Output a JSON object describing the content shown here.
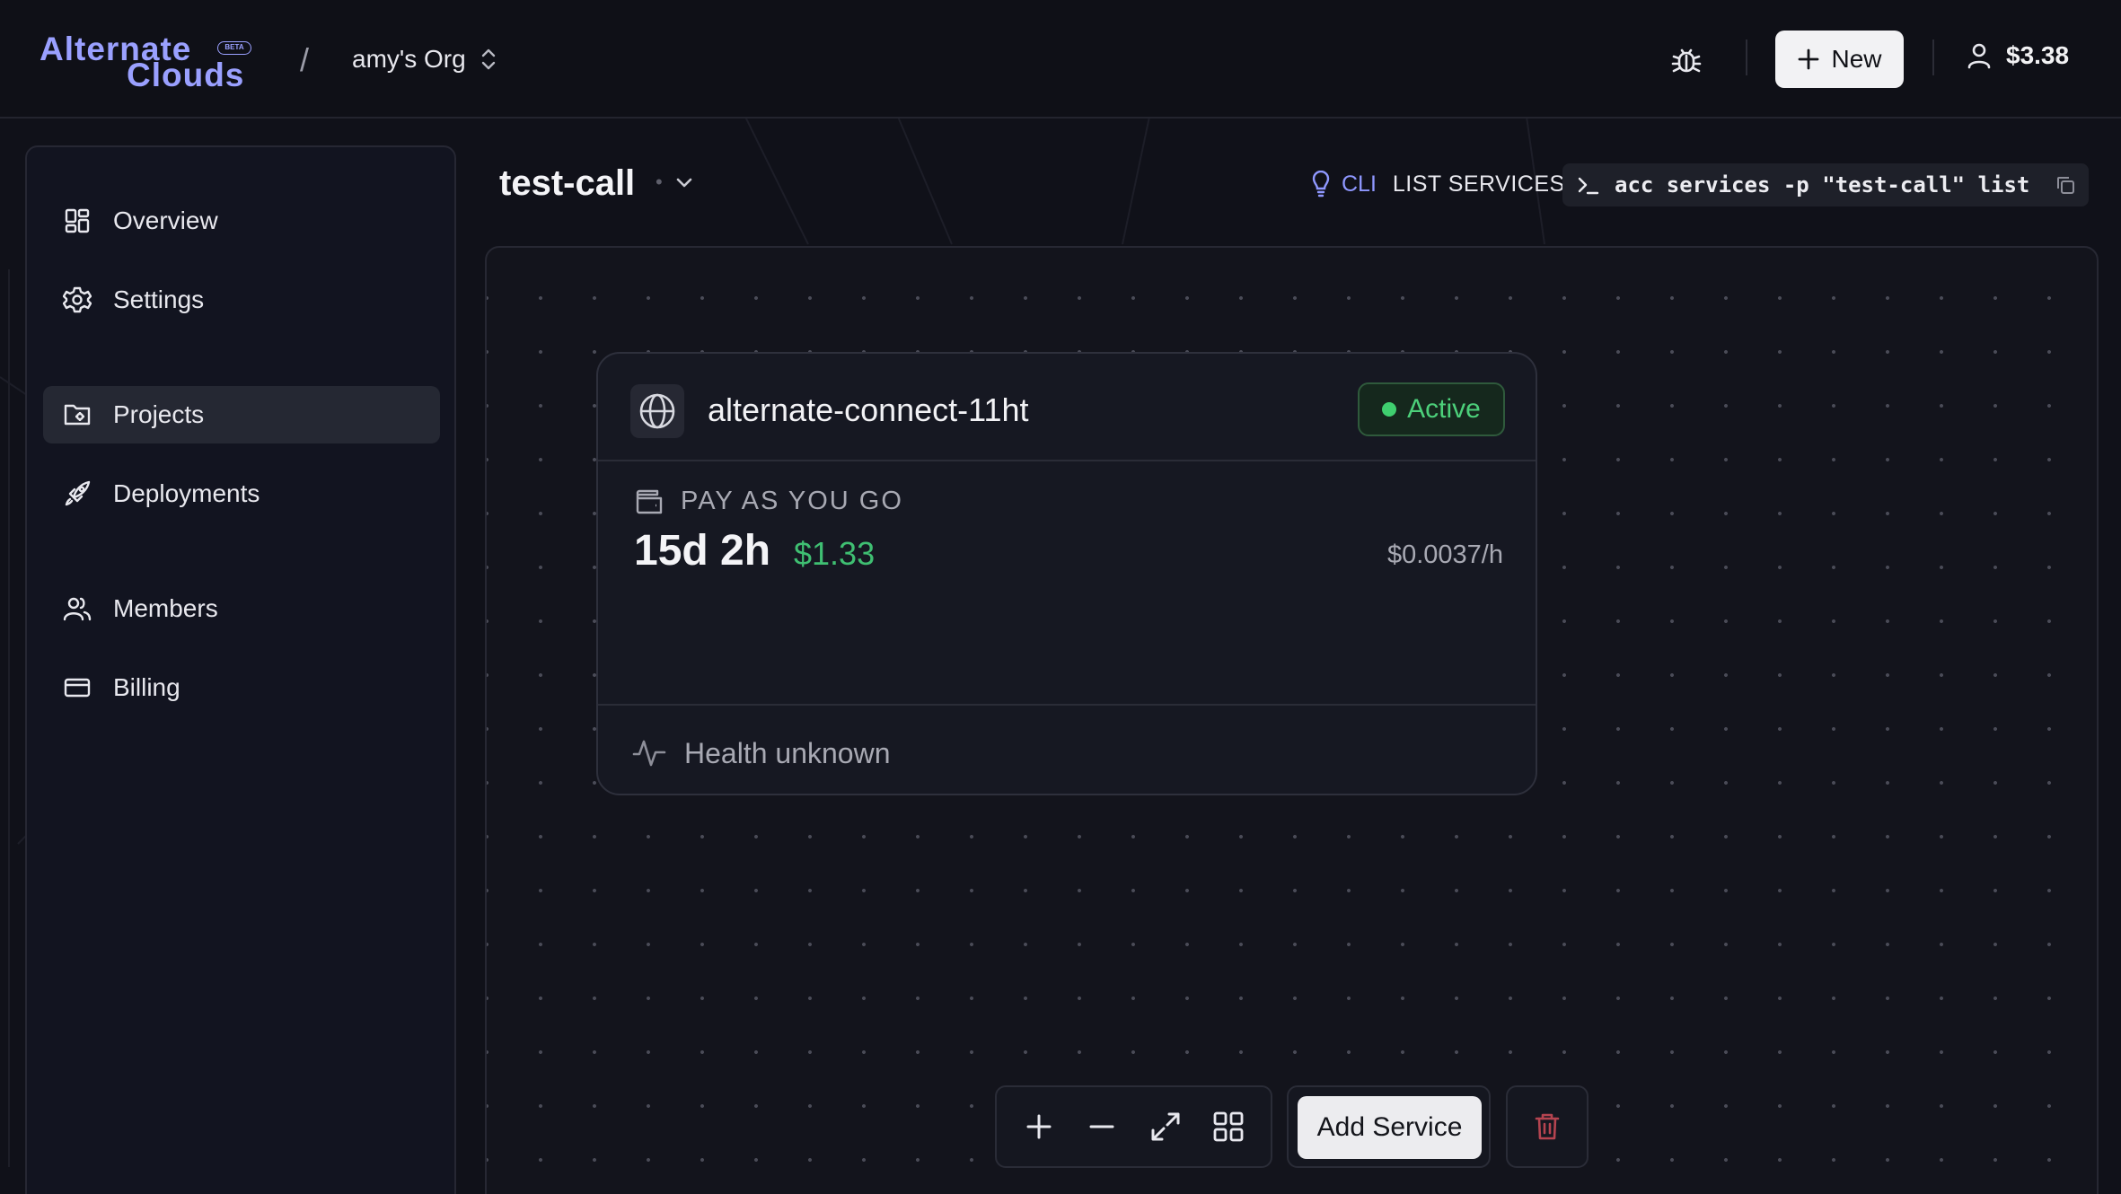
{
  "brand": {
    "line1": "Alternate",
    "line2": "Clouds",
    "badge": "BETA",
    "color": "#9aa0ff"
  },
  "breadcrumb": {
    "separator": "/",
    "org": "amy's Org"
  },
  "header": {
    "new_label": "New",
    "balance": "$3.38"
  },
  "sidebar": {
    "items": [
      {
        "label": "Overview",
        "icon": "grid-icon"
      },
      {
        "label": "Settings",
        "icon": "gear-icon"
      },
      {
        "label": "Projects",
        "icon": "folder-icon",
        "active": true
      },
      {
        "label": "Deployments",
        "icon": "rocket-icon"
      },
      {
        "label": "Members",
        "icon": "users-icon"
      },
      {
        "label": "Billing",
        "icon": "card-icon"
      }
    ]
  },
  "project": {
    "name": "test-call",
    "dot": "•"
  },
  "cli": {
    "label": "CLI",
    "subject": "LIST SERVICES",
    "command": "acc services -p \"test-call\" list"
  },
  "service": {
    "name": "alternate-connect-11ht",
    "status": "Active",
    "plan": "PAY AS YOU GO",
    "uptime": "15d 2h",
    "cost": "$1.33",
    "rate": "$0.0037/h",
    "health": "Health unknown",
    "status_color": "#3fcf6f"
  },
  "toolbar": {
    "add_service_label": "Add Service"
  }
}
